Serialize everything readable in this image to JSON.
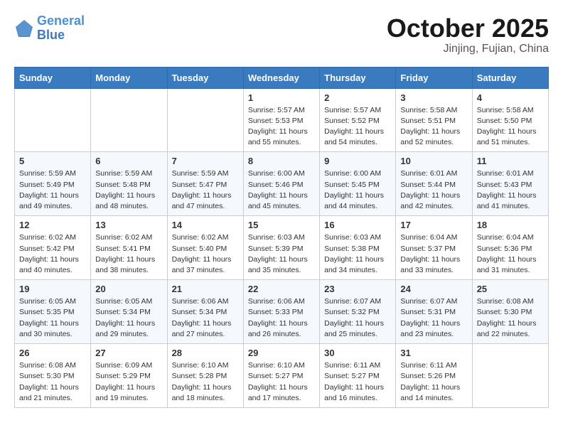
{
  "header": {
    "logo_line1": "General",
    "logo_line2": "Blue",
    "month": "October 2025",
    "location": "Jinjing, Fujian, China"
  },
  "weekdays": [
    "Sunday",
    "Monday",
    "Tuesday",
    "Wednesday",
    "Thursday",
    "Friday",
    "Saturday"
  ],
  "weeks": [
    [
      {
        "day": "",
        "text": ""
      },
      {
        "day": "",
        "text": ""
      },
      {
        "day": "",
        "text": ""
      },
      {
        "day": "1",
        "text": "Sunrise: 5:57 AM\nSunset: 5:53 PM\nDaylight: 11 hours and 55 minutes."
      },
      {
        "day": "2",
        "text": "Sunrise: 5:57 AM\nSunset: 5:52 PM\nDaylight: 11 hours and 54 minutes."
      },
      {
        "day": "3",
        "text": "Sunrise: 5:58 AM\nSunset: 5:51 PM\nDaylight: 11 hours and 52 minutes."
      },
      {
        "day": "4",
        "text": "Sunrise: 5:58 AM\nSunset: 5:50 PM\nDaylight: 11 hours and 51 minutes."
      }
    ],
    [
      {
        "day": "5",
        "text": "Sunrise: 5:59 AM\nSunset: 5:49 PM\nDaylight: 11 hours and 49 minutes."
      },
      {
        "day": "6",
        "text": "Sunrise: 5:59 AM\nSunset: 5:48 PM\nDaylight: 11 hours and 48 minutes."
      },
      {
        "day": "7",
        "text": "Sunrise: 5:59 AM\nSunset: 5:47 PM\nDaylight: 11 hours and 47 minutes."
      },
      {
        "day": "8",
        "text": "Sunrise: 6:00 AM\nSunset: 5:46 PM\nDaylight: 11 hours and 45 minutes."
      },
      {
        "day": "9",
        "text": "Sunrise: 6:00 AM\nSunset: 5:45 PM\nDaylight: 11 hours and 44 minutes."
      },
      {
        "day": "10",
        "text": "Sunrise: 6:01 AM\nSunset: 5:44 PM\nDaylight: 11 hours and 42 minutes."
      },
      {
        "day": "11",
        "text": "Sunrise: 6:01 AM\nSunset: 5:43 PM\nDaylight: 11 hours and 41 minutes."
      }
    ],
    [
      {
        "day": "12",
        "text": "Sunrise: 6:02 AM\nSunset: 5:42 PM\nDaylight: 11 hours and 40 minutes."
      },
      {
        "day": "13",
        "text": "Sunrise: 6:02 AM\nSunset: 5:41 PM\nDaylight: 11 hours and 38 minutes."
      },
      {
        "day": "14",
        "text": "Sunrise: 6:02 AM\nSunset: 5:40 PM\nDaylight: 11 hours and 37 minutes."
      },
      {
        "day": "15",
        "text": "Sunrise: 6:03 AM\nSunset: 5:39 PM\nDaylight: 11 hours and 35 minutes."
      },
      {
        "day": "16",
        "text": "Sunrise: 6:03 AM\nSunset: 5:38 PM\nDaylight: 11 hours and 34 minutes."
      },
      {
        "day": "17",
        "text": "Sunrise: 6:04 AM\nSunset: 5:37 PM\nDaylight: 11 hours and 33 minutes."
      },
      {
        "day": "18",
        "text": "Sunrise: 6:04 AM\nSunset: 5:36 PM\nDaylight: 11 hours and 31 minutes."
      }
    ],
    [
      {
        "day": "19",
        "text": "Sunrise: 6:05 AM\nSunset: 5:35 PM\nDaylight: 11 hours and 30 minutes."
      },
      {
        "day": "20",
        "text": "Sunrise: 6:05 AM\nSunset: 5:34 PM\nDaylight: 11 hours and 29 minutes."
      },
      {
        "day": "21",
        "text": "Sunrise: 6:06 AM\nSunset: 5:34 PM\nDaylight: 11 hours and 27 minutes."
      },
      {
        "day": "22",
        "text": "Sunrise: 6:06 AM\nSunset: 5:33 PM\nDaylight: 11 hours and 26 minutes."
      },
      {
        "day": "23",
        "text": "Sunrise: 6:07 AM\nSunset: 5:32 PM\nDaylight: 11 hours and 25 minutes."
      },
      {
        "day": "24",
        "text": "Sunrise: 6:07 AM\nSunset: 5:31 PM\nDaylight: 11 hours and 23 minutes."
      },
      {
        "day": "25",
        "text": "Sunrise: 6:08 AM\nSunset: 5:30 PM\nDaylight: 11 hours and 22 minutes."
      }
    ],
    [
      {
        "day": "26",
        "text": "Sunrise: 6:08 AM\nSunset: 5:30 PM\nDaylight: 11 hours and 21 minutes."
      },
      {
        "day": "27",
        "text": "Sunrise: 6:09 AM\nSunset: 5:29 PM\nDaylight: 11 hours and 19 minutes."
      },
      {
        "day": "28",
        "text": "Sunrise: 6:10 AM\nSunset: 5:28 PM\nDaylight: 11 hours and 18 minutes."
      },
      {
        "day": "29",
        "text": "Sunrise: 6:10 AM\nSunset: 5:27 PM\nDaylight: 11 hours and 17 minutes."
      },
      {
        "day": "30",
        "text": "Sunrise: 6:11 AM\nSunset: 5:27 PM\nDaylight: 11 hours and 16 minutes."
      },
      {
        "day": "31",
        "text": "Sunrise: 6:11 AM\nSunset: 5:26 PM\nDaylight: 11 hours and 14 minutes."
      },
      {
        "day": "",
        "text": ""
      }
    ]
  ]
}
